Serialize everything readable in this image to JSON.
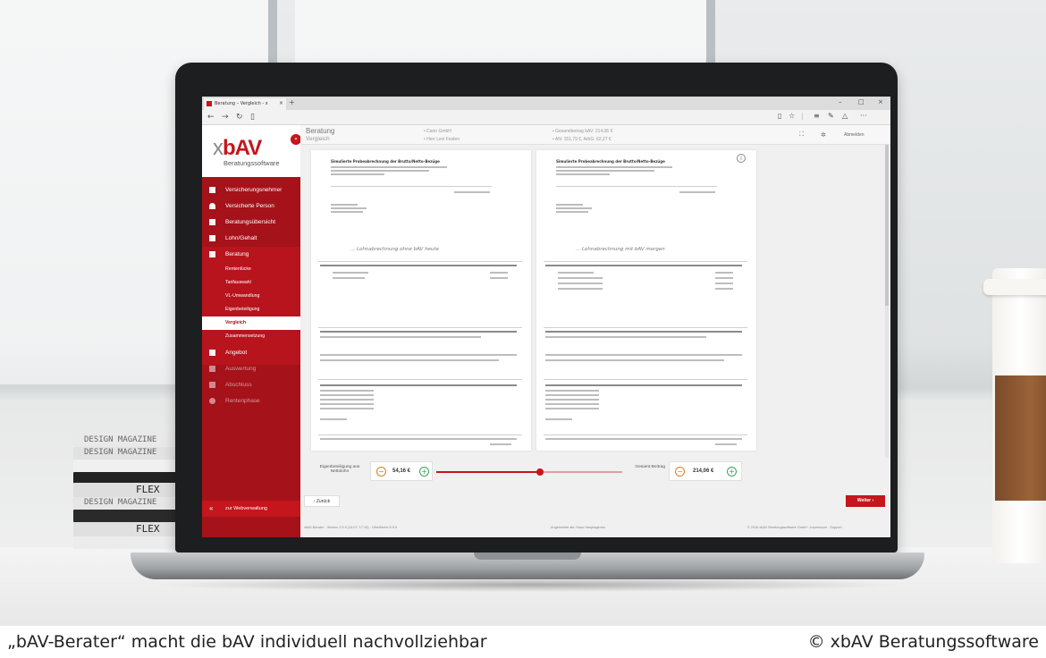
{
  "browser": {
    "tab_title": "Beratung – Vergleich - x",
    "tab_close": "×",
    "new_tab": "+",
    "win_min": "–",
    "win_max": "□",
    "win_close": "×",
    "nav_back": "←",
    "nav_forward": "→",
    "nav_reload": "↻",
    "address_icon": "▯",
    "right_icons": [
      "▯",
      "☆",
      "|",
      "≡",
      "✎",
      "△",
      "···"
    ]
  },
  "sidebar": {
    "logo_x": "x",
    "logo_bav": "bAV",
    "logo_subtitle": "Beratungssoftware",
    "collapse": "«",
    "items": [
      {
        "label": "Versicherungsnehmer",
        "icon": "chart-icon"
      },
      {
        "label": "Versicherte Person",
        "icon": "person-icon"
      },
      {
        "label": "Beratungsübersicht",
        "icon": "overview-icon"
      },
      {
        "label": "Lohn/Gehalt",
        "icon": "payslip-icon"
      },
      {
        "label": "Beratung",
        "icon": "people-icon"
      }
    ],
    "sub_items": [
      "Rentenlücke",
      "Tarifauswahl",
      "VL-Umwandlung",
      "Eigenbeteiligung",
      "Vergleich",
      "Zusammensetzung"
    ],
    "active_sub": "Vergleich",
    "items_after": [
      {
        "label": "Angebot",
        "icon": "document-icon",
        "dim": false
      },
      {
        "label": "Auswertung",
        "icon": "bar-chart-icon",
        "dim": true
      },
      {
        "label": "Abschluss",
        "icon": "flag-icon",
        "dim": true
      },
      {
        "label": "Rentenphase",
        "icon": "infinity-icon",
        "dim": true
      }
    ],
    "admin_label": "zur Webverwaltung",
    "admin_icon": "«"
  },
  "header": {
    "title": "Beratung",
    "subtitle": "Vergleich",
    "company": "• Carlo GmbH",
    "person": "• Herr Levi Festen",
    "total": "• Gesamtbetrag bAV: 214,06 €",
    "split": "• AN: 151,79 €, ArbG: 62,27 €",
    "expand_icon": "⛶",
    "settings_icon": "✲",
    "logout": "Abmelden"
  },
  "documents": [
    {
      "title": "Simulierte Probeabrechnung der Brutto/Netto-Bezüge",
      "overlay": "... Lohnabrechnung ohne bAV heute"
    },
    {
      "title": "Simulierte Probeabrechnung der Brutto/Netto-Bezüge",
      "overlay": "... Lohnabrechnung mit bAV morgen",
      "info_icon": "i"
    }
  ],
  "slider": {
    "label": "Eigenbeteiligung aus Nettolohn",
    "value": "54,16 €",
    "total_label": "Gesamt-Beitrag",
    "total_value": "214,06 €",
    "minus": "−",
    "plus": "+"
  },
  "footer": {
    "back": "‹ Zurück",
    "next": "Weiter ›",
    "version": "xbAV-Berater - Version 2.9.0 (14.07. 17:19) - Oberfläche 8.5.5",
    "login": "Angemeldet als: Hans Hauptagentur",
    "copyright": "© 2016 xbAV Beratungssoftware GmbH - Impressum - Support"
  },
  "magazines": [
    "DESIGN MAGAZINE",
    "DESIGN MAGAZINE",
    "FLEX MAGAZ",
    "DESIGN MAGAZINE",
    "FLEX MAGAZ"
  ],
  "caption": {
    "left": "„bAV-Berater“ macht die bAV individuell nachvollziehbar",
    "right": "© xbAV Beratungssoftware"
  },
  "colors": {
    "brand_red": "#c4161c",
    "sidebar_red": "#a5121a",
    "minus_orange": "#e07a1f",
    "plus_green": "#3aa35a"
  }
}
